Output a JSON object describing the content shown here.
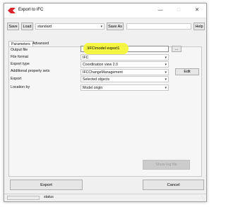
{
  "window": {
    "title": "Export to IFC"
  },
  "toolbar": {
    "save_label": "Save",
    "load_label": "Load",
    "config_value": "standard",
    "save_as_label": "Save As",
    "save_as_field": "",
    "help_label": "Help"
  },
  "tabs": [
    {
      "label": "Parameters",
      "active": true
    },
    {
      "label": "Advanced",
      "active": false
    }
  ],
  "form": {
    "output_file": {
      "label": "Output file",
      "value": ".\\IFC\\model export1",
      "browse_label": "..."
    },
    "file_format": {
      "label": "File format",
      "value": "IFC"
    },
    "export_type": {
      "label": "Export type",
      "value": "Coordination view 2.0"
    },
    "additional_property_sets": {
      "label": "Additional property sets",
      "value": "IFCChangeManagement",
      "edit_label": "Edit"
    },
    "export": {
      "label": "Export",
      "value": "Selected objects"
    },
    "location_by": {
      "label": "Location by",
      "value": "Model origin"
    }
  },
  "panel_button": {
    "label": "Show log file"
  },
  "footer": {
    "export_label": "Export",
    "cancel_label": "Cancel"
  },
  "statusbar": {
    "text": "status"
  },
  "colors": {
    "highlight": "#f5f53a",
    "app_icon": "#d9262c"
  },
  "icons": {
    "app": "tekla-icon",
    "dropdown": "chevron-down-icon"
  }
}
